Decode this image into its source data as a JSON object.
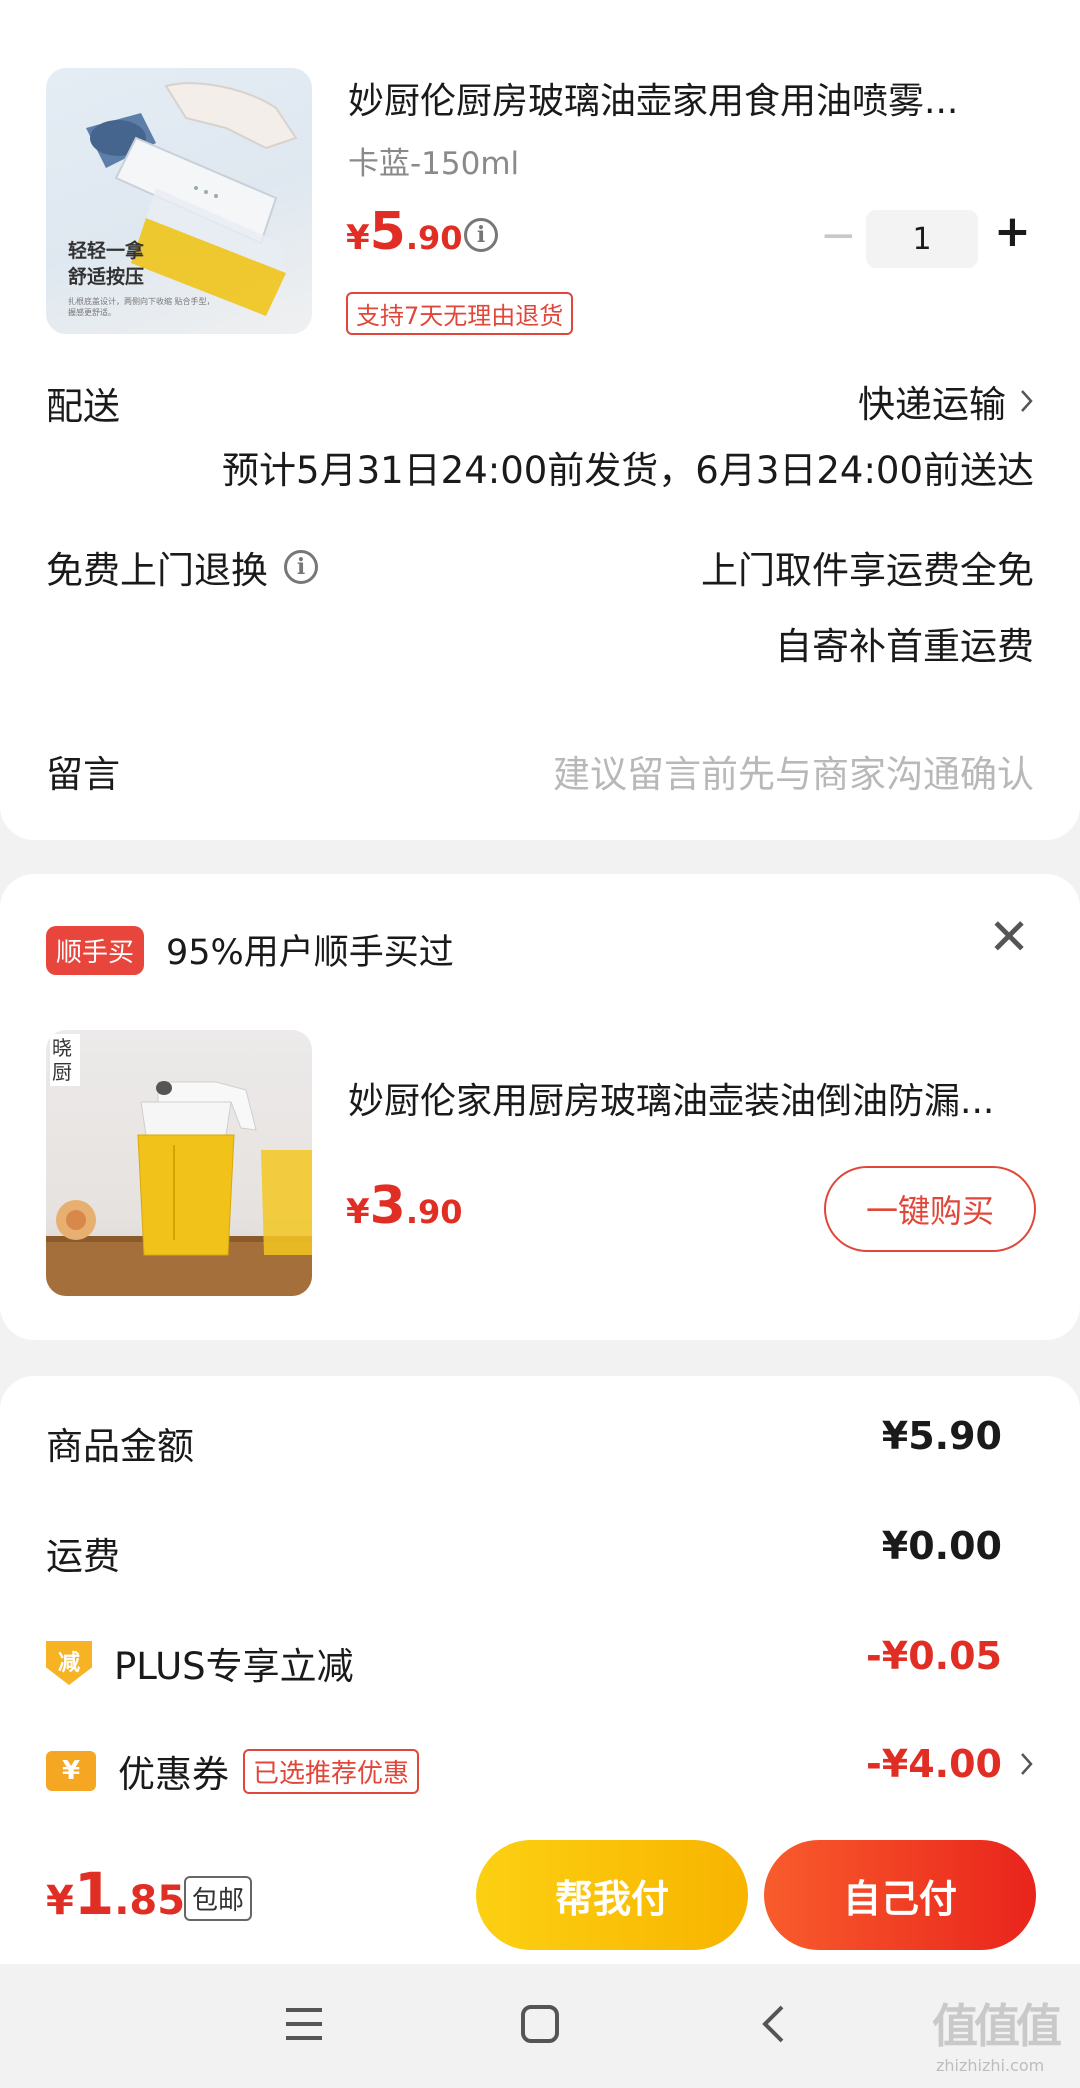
{
  "product": {
    "title": "妙厨伦厨房玻璃油壶家用食用油喷雾...",
    "sku": "卡蓝-150ml",
    "price_currency": "¥",
    "price_int": "5",
    "price_dec": ".90",
    "image_caption_1": "轻轻一拿",
    "image_caption_2": "舒适按压",
    "image_caption_small": "扎根底盖设计，两侧向下收缩 贴合手型，握感更舒适。",
    "return_policy_tag": "支持7天无理由退货",
    "quantity": "1",
    "minus_label": "−",
    "plus_label": "+"
  },
  "delivery": {
    "label": "配送",
    "method": "快递运输",
    "estimate": "预计5月31日24:00前发货，6月3日24:00前送达"
  },
  "returns": {
    "label": "免费上门退换",
    "line1": "上门取件享运费全免",
    "line2": "自寄补首重运费"
  },
  "message": {
    "label": "留言",
    "placeholder": "建议留言前先与商家沟通确认"
  },
  "addon": {
    "badge": "顺手买",
    "headline": "95%用户顺手买过",
    "title": "妙厨伦家用厨房玻璃油壶装油倒油防漏...",
    "image_text": "晓厨",
    "price_currency": "¥",
    "price_int": "3",
    "price_dec": ".90",
    "button": "一键购买"
  },
  "summary": {
    "goods_label": "商品金额",
    "goods_value": "¥5.90",
    "shipping_label": "运费",
    "shipping_value": "¥0.00",
    "plus_icon_text": "减",
    "plus_label": "PLUS专享立减",
    "plus_value": "-¥0.05",
    "coupon_icon_text": "¥",
    "coupon_label": "优惠券",
    "coupon_tag": "已选推荐优惠",
    "coupon_value": "-¥4.00"
  },
  "footer": {
    "total_currency": "¥",
    "total_int": "1",
    "total_dec": ".85",
    "free_shipping": "包邮",
    "help_pay": "帮我付",
    "self_pay": "自己付"
  },
  "watermark": {
    "logo": "值值值",
    "domain": "zhizhizhi.com"
  },
  "colors": {
    "accent_red": "#e02e24",
    "help_pay_gradient": [
      "#fcd012",
      "#f8b400"
    ],
    "self_pay_gradient": [
      "#f85c2c",
      "#e9241c"
    ]
  },
  "icons": [
    "info-icon",
    "chevron-right-icon",
    "close-icon",
    "minus-reduce-icon",
    "coupon-yen-icon",
    "menu-icon",
    "home-square-icon",
    "back-icon"
  ]
}
